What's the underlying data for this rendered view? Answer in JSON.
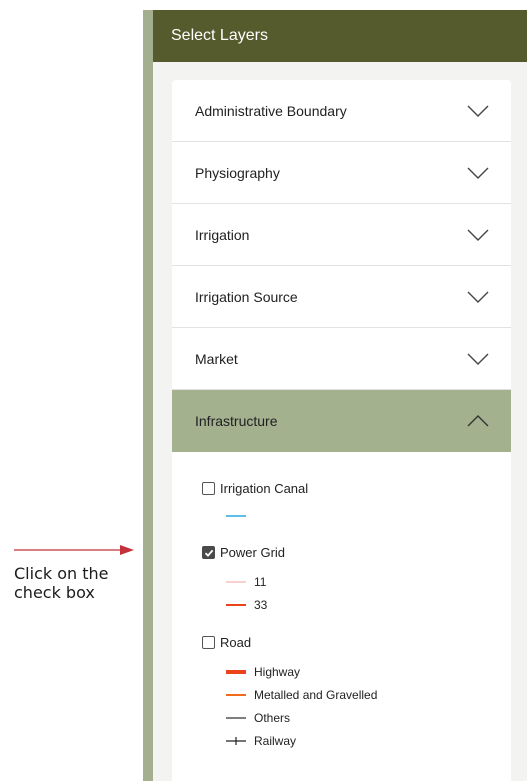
{
  "panel": {
    "title": "Select Layers"
  },
  "accordion": {
    "items": [
      {
        "label": "Administrative Boundary",
        "expanded": false
      },
      {
        "label": "Physiography",
        "expanded": false
      },
      {
        "label": "Irrigation",
        "expanded": false
      },
      {
        "label": "Irrigation Source",
        "expanded": false
      },
      {
        "label": "Market",
        "expanded": false
      },
      {
        "label": "Infrastructure",
        "expanded": true
      }
    ]
  },
  "infrastructure": {
    "layers": [
      {
        "label": "Irrigation Canal",
        "checked": false,
        "legend": [
          {
            "label": "",
            "color": "#29a8e0"
          }
        ]
      },
      {
        "label": "Power Grid",
        "checked": true,
        "legend": [
          {
            "label": "11",
            "color": "#f5b5b5"
          },
          {
            "label": "33",
            "color": "#e8431d"
          }
        ]
      },
      {
        "label": "Road",
        "checked": false,
        "legend": [
          {
            "label": "Highway",
            "color": "#e8431d"
          },
          {
            "label": "Metalled and Gravelled",
            "color": "#f26b1d"
          },
          {
            "label": "Others",
            "color": "#333333"
          },
          {
            "label": "Railway",
            "color": "#222222"
          }
        ]
      }
    ]
  },
  "annotation": {
    "text": "Click on the check box",
    "arrow_color": "#c4313a"
  },
  "colors": {
    "header": "#555b2c",
    "active_item": "#a3b18e",
    "strip": "#a3af8f"
  }
}
